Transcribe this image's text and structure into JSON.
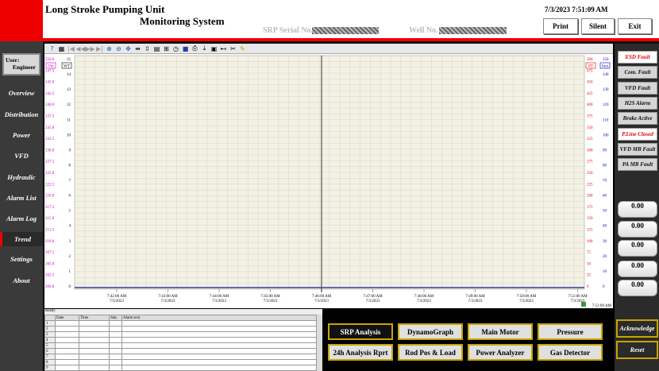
{
  "header": {
    "title_line1": "Long Stroke Pumping Unit",
    "title_line2": "Monitoring System",
    "serial_label": "SRP Serial No.",
    "well_label": "Well No.",
    "clock": "7/3/2023 7:51:09 AM",
    "print": "Print",
    "silent": "Silent",
    "exit": "Exit"
  },
  "user": {
    "label": "User:",
    "name": "Engineer"
  },
  "nav": [
    "Overview",
    "Distribution",
    "Power",
    "VFD",
    "Hydraulic",
    "Alarm List",
    "Alarm Log",
    "Trend",
    "Settings",
    "About"
  ],
  "nav_active": "Trend",
  "chart_data": {
    "type": "line",
    "left_axis_outer": {
      "label": "Vin",
      "ticks": [
        "250.0",
        "247.5",
        "245.0",
        "242.5",
        "240.0",
        "237.5",
        "235.0",
        "232.5",
        "230.0",
        "227.5",
        "225.0",
        "222.5",
        "220.0",
        "217.5",
        "215.0",
        "212.5",
        "210.0",
        "207.5",
        "205.0",
        "202.5",
        "200.0"
      ],
      "color": "#c000c0"
    },
    "left_axis_inner": {
      "label": "WT",
      "ticks": [
        "15",
        "14",
        "13",
        "12",
        "11",
        "10",
        "9",
        "8",
        "7",
        "6",
        "5",
        "4",
        "3",
        "2",
        "1",
        "0"
      ],
      "color": "#000000"
    },
    "right_axis_inner": {
      "label": "PT",
      "ticks": [
        "500",
        "475",
        "450",
        "425",
        "400",
        "375",
        "350",
        "325",
        "300",
        "275",
        "250",
        "225",
        "200",
        "175",
        "150",
        "125",
        "100",
        "75",
        "50",
        "25",
        "0"
      ],
      "color": "#e00000"
    },
    "right_axis_outer": {
      "label": "Iout",
      "ticks": [
        "150",
        "140",
        "130",
        "120",
        "110",
        "100",
        "90",
        "80",
        "70",
        "60",
        "50",
        "40",
        "30",
        "20",
        "10",
        "0"
      ],
      "color": "#0000c0"
    },
    "x_ticks": [
      {
        "time": "7:42:00 AM",
        "date": "7/3/2023"
      },
      {
        "time": "7:43:00 AM",
        "date": "7/3/2023"
      },
      {
        "time": "7:44:00 AM",
        "date": "7/3/2023"
      },
      {
        "time": "7:45:00 AM",
        "date": "7/3/2023"
      },
      {
        "time": "7:46:00 AM",
        "date": "7/3/2023"
      },
      {
        "time": "7:47:00 AM",
        "date": "7/3/2023"
      },
      {
        "time": "7:48:00 AM",
        "date": "7/3/2023"
      },
      {
        "time": "7:49:00 AM",
        "date": "7/3/2023"
      },
      {
        "time": "7:50:00 AM",
        "date": "7/3/2023"
      },
      {
        "time": "7:51:00 AM",
        "date": "7/3/2023"
      }
    ],
    "cursor_time": "7:46:00 AM",
    "series_line_value": 0,
    "grid": true,
    "bottom_stamp": "7:51:09 AM"
  },
  "alarm_table": {
    "status": "Ready",
    "headers": [
      "Date",
      "Time",
      "Stat.",
      "Alarm text"
    ],
    "rows": [
      "1",
      "2",
      "3",
      "4",
      "5",
      "6",
      "7",
      "8",
      "9"
    ]
  },
  "bottom_buttons": [
    "SRP Analysis",
    "DynamoGraph",
    "Main Motor",
    "Pressure",
    "24h Analysis Rprt",
    "Rod Pos & Load",
    "Power Analyzer",
    "Gas Detector"
  ],
  "faults": [
    {
      "label": "ESD Fault",
      "active": true
    },
    {
      "label": "Com. Fault",
      "active": false
    },
    {
      "label": "VFD Fault",
      "active": false
    },
    {
      "label": "H2S Alarm",
      "active": false
    },
    {
      "label": "Brake Active",
      "active": false
    },
    {
      "label": "P.Line Closed",
      "active": true
    },
    {
      "label": "VFD MB Fault",
      "active": false
    },
    {
      "label": "PA MB Fault",
      "active": false
    }
  ],
  "gauges": [
    "0.00",
    "0.00",
    "0.00",
    "0.00",
    "0.00"
  ],
  "actions": {
    "acknowledge": "Acknowledge",
    "reset": "Reset"
  }
}
